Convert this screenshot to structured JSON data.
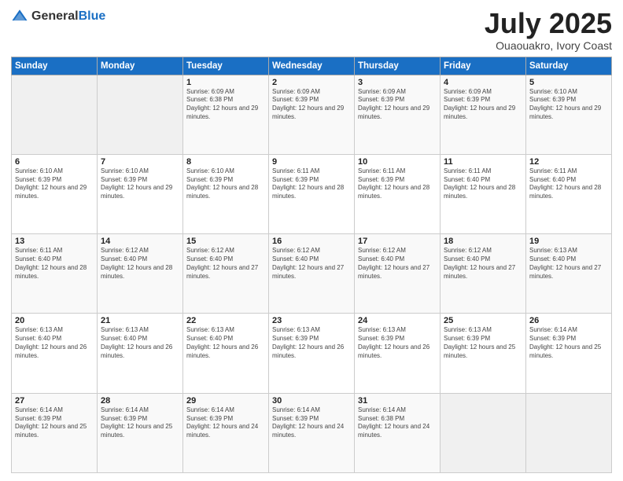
{
  "header": {
    "logo_general": "General",
    "logo_blue": "Blue",
    "title": "July 2025",
    "location": "Ouaouakro, Ivory Coast"
  },
  "days_of_week": [
    "Sunday",
    "Monday",
    "Tuesday",
    "Wednesday",
    "Thursday",
    "Friday",
    "Saturday"
  ],
  "weeks": [
    [
      {
        "day": "",
        "info": ""
      },
      {
        "day": "",
        "info": ""
      },
      {
        "day": "1",
        "info": "Sunrise: 6:09 AM\nSunset: 6:38 PM\nDaylight: 12 hours and 29 minutes."
      },
      {
        "day": "2",
        "info": "Sunrise: 6:09 AM\nSunset: 6:39 PM\nDaylight: 12 hours and 29 minutes."
      },
      {
        "day": "3",
        "info": "Sunrise: 6:09 AM\nSunset: 6:39 PM\nDaylight: 12 hours and 29 minutes."
      },
      {
        "day": "4",
        "info": "Sunrise: 6:09 AM\nSunset: 6:39 PM\nDaylight: 12 hours and 29 minutes."
      },
      {
        "day": "5",
        "info": "Sunrise: 6:10 AM\nSunset: 6:39 PM\nDaylight: 12 hours and 29 minutes."
      }
    ],
    [
      {
        "day": "6",
        "info": "Sunrise: 6:10 AM\nSunset: 6:39 PM\nDaylight: 12 hours and 29 minutes."
      },
      {
        "day": "7",
        "info": "Sunrise: 6:10 AM\nSunset: 6:39 PM\nDaylight: 12 hours and 29 minutes."
      },
      {
        "day": "8",
        "info": "Sunrise: 6:10 AM\nSunset: 6:39 PM\nDaylight: 12 hours and 28 minutes."
      },
      {
        "day": "9",
        "info": "Sunrise: 6:11 AM\nSunset: 6:39 PM\nDaylight: 12 hours and 28 minutes."
      },
      {
        "day": "10",
        "info": "Sunrise: 6:11 AM\nSunset: 6:39 PM\nDaylight: 12 hours and 28 minutes."
      },
      {
        "day": "11",
        "info": "Sunrise: 6:11 AM\nSunset: 6:40 PM\nDaylight: 12 hours and 28 minutes."
      },
      {
        "day": "12",
        "info": "Sunrise: 6:11 AM\nSunset: 6:40 PM\nDaylight: 12 hours and 28 minutes."
      }
    ],
    [
      {
        "day": "13",
        "info": "Sunrise: 6:11 AM\nSunset: 6:40 PM\nDaylight: 12 hours and 28 minutes."
      },
      {
        "day": "14",
        "info": "Sunrise: 6:12 AM\nSunset: 6:40 PM\nDaylight: 12 hours and 28 minutes."
      },
      {
        "day": "15",
        "info": "Sunrise: 6:12 AM\nSunset: 6:40 PM\nDaylight: 12 hours and 27 minutes."
      },
      {
        "day": "16",
        "info": "Sunrise: 6:12 AM\nSunset: 6:40 PM\nDaylight: 12 hours and 27 minutes."
      },
      {
        "day": "17",
        "info": "Sunrise: 6:12 AM\nSunset: 6:40 PM\nDaylight: 12 hours and 27 minutes."
      },
      {
        "day": "18",
        "info": "Sunrise: 6:12 AM\nSunset: 6:40 PM\nDaylight: 12 hours and 27 minutes."
      },
      {
        "day": "19",
        "info": "Sunrise: 6:13 AM\nSunset: 6:40 PM\nDaylight: 12 hours and 27 minutes."
      }
    ],
    [
      {
        "day": "20",
        "info": "Sunrise: 6:13 AM\nSunset: 6:40 PM\nDaylight: 12 hours and 26 minutes."
      },
      {
        "day": "21",
        "info": "Sunrise: 6:13 AM\nSunset: 6:40 PM\nDaylight: 12 hours and 26 minutes."
      },
      {
        "day": "22",
        "info": "Sunrise: 6:13 AM\nSunset: 6:40 PM\nDaylight: 12 hours and 26 minutes."
      },
      {
        "day": "23",
        "info": "Sunrise: 6:13 AM\nSunset: 6:39 PM\nDaylight: 12 hours and 26 minutes."
      },
      {
        "day": "24",
        "info": "Sunrise: 6:13 AM\nSunset: 6:39 PM\nDaylight: 12 hours and 26 minutes."
      },
      {
        "day": "25",
        "info": "Sunrise: 6:13 AM\nSunset: 6:39 PM\nDaylight: 12 hours and 25 minutes."
      },
      {
        "day": "26",
        "info": "Sunrise: 6:14 AM\nSunset: 6:39 PM\nDaylight: 12 hours and 25 minutes."
      }
    ],
    [
      {
        "day": "27",
        "info": "Sunrise: 6:14 AM\nSunset: 6:39 PM\nDaylight: 12 hours and 25 minutes."
      },
      {
        "day": "28",
        "info": "Sunrise: 6:14 AM\nSunset: 6:39 PM\nDaylight: 12 hours and 25 minutes."
      },
      {
        "day": "29",
        "info": "Sunrise: 6:14 AM\nSunset: 6:39 PM\nDaylight: 12 hours and 24 minutes."
      },
      {
        "day": "30",
        "info": "Sunrise: 6:14 AM\nSunset: 6:39 PM\nDaylight: 12 hours and 24 minutes."
      },
      {
        "day": "31",
        "info": "Sunrise: 6:14 AM\nSunset: 6:38 PM\nDaylight: 12 hours and 24 minutes."
      },
      {
        "day": "",
        "info": ""
      },
      {
        "day": "",
        "info": ""
      }
    ]
  ]
}
